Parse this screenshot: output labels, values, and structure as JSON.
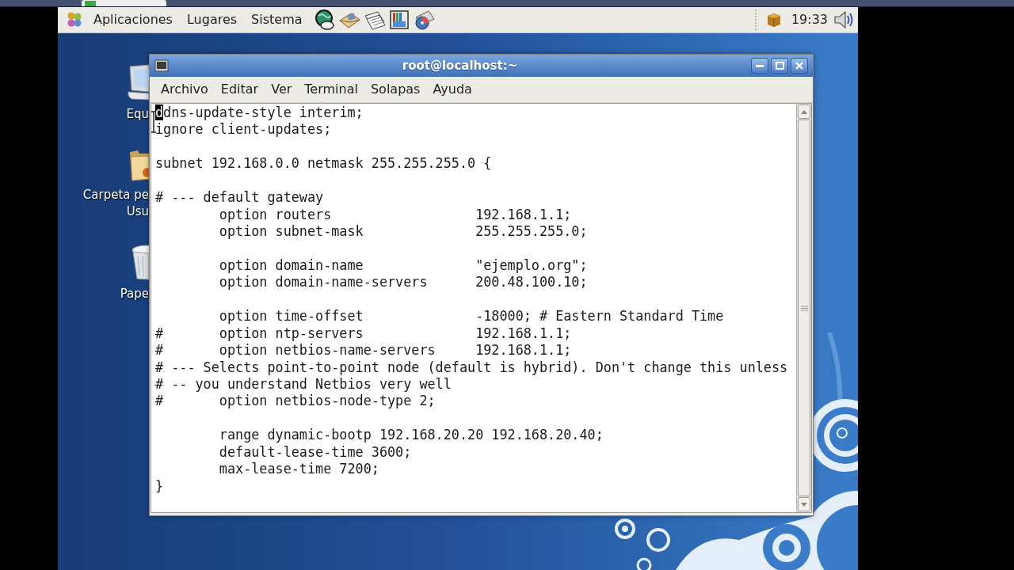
{
  "panel": {
    "menus": [
      "Aplicaciones",
      "Lugares",
      "Sistema"
    ],
    "clock": "19:33"
  },
  "desktop_icons": [
    {
      "kind": "computer",
      "label": [
        "Equ"
      ]
    },
    {
      "kind": "folder",
      "label": [
        "Carpeta pe",
        "Usu"
      ]
    },
    {
      "kind": "trash",
      "label": [
        "Pape"
      ]
    }
  ],
  "terminal": {
    "title": "root@localhost:~",
    "menu": [
      "Archivo",
      "Editar",
      "Ver",
      "Terminal",
      "Solapas",
      "Ayuda"
    ],
    "blocks": [
      [
        {
          "text": "ddns-update-style interim;",
          "cursor": true
        },
        {
          "text": "ignore client-updates;",
          "cursor": false
        }
      ],
      [
        {
          "text": "subnet 192.168.0.0 netmask 255.255.255.0 {",
          "cursor": false
        }
      ],
      [
        {
          "text": "# --- default gateway",
          "cursor": false
        },
        {
          "text": "        option routers                  192.168.1.1;",
          "cursor": false
        },
        {
          "text": "        option subnet-mask              255.255.255.0;",
          "cursor": false
        }
      ],
      [
        {
          "text": "        option domain-name              \"ejemplo.org\";",
          "cursor": false
        },
        {
          "text": "        option domain-name-servers      200.48.100.10;",
          "cursor": false
        }
      ],
      [
        {
          "text": "        option time-offset              -18000; # Eastern Standard Time",
          "cursor": false
        },
        {
          "text": "#       option ntp-servers              192.168.1.1;",
          "cursor": false
        },
        {
          "text": "#       option netbios-name-servers     192.168.1.1;",
          "cursor": false
        },
        {
          "text": "# --- Selects point-to-point node (default is hybrid). Don't change this unless",
          "cursor": false
        },
        {
          "text": "# -- you understand Netbios very well",
          "cursor": false
        },
        {
          "text": "#       option netbios-node-type 2;",
          "cursor": false
        }
      ],
      [
        {
          "text": "        range dynamic-bootp 192.168.20.20 192.168.20.40;",
          "cursor": false
        },
        {
          "text": "        default-lease-time 3600;",
          "cursor": false
        },
        {
          "text": "        max-lease-time 7200;",
          "cursor": false
        },
        {
          "text": "}",
          "cursor": false
        }
      ]
    ]
  }
}
